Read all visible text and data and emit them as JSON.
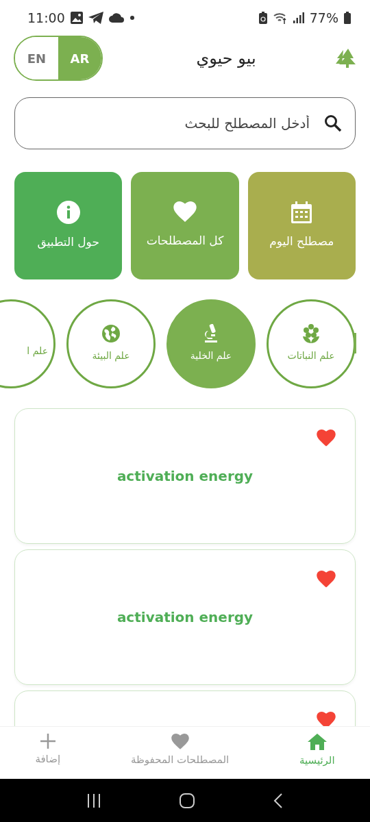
{
  "status_bar": {
    "time": "11:00",
    "battery": "77%"
  },
  "header": {
    "title": "بيو حيوي",
    "languages": [
      {
        "label": "AR",
        "selected": true
      },
      {
        "label": "EN",
        "selected": false
      }
    ]
  },
  "search": {
    "placeholder": "أدخل المصطلح للبحث"
  },
  "tiles": [
    {
      "label": "مصطلح اليوم",
      "color": "#a9ae4e"
    },
    {
      "label": "كل المصطلحات",
      "color": "#7cb050"
    },
    {
      "label": "حول التطبيق",
      "color": "#4fae56"
    }
  ],
  "categories": [
    {
      "label": "علم النباتات",
      "selected": false
    },
    {
      "label": "علم الخلية",
      "selected": true
    },
    {
      "label": "علم البيئة",
      "selected": false
    },
    {
      "label": "علم ا",
      "selected": false
    }
  ],
  "terms": [
    {
      "term": "activation energy",
      "favorite": true
    },
    {
      "term": "activation energy",
      "favorite": true
    },
    {
      "favorite": true
    }
  ],
  "bottom_nav": [
    {
      "label": "الرئيسية",
      "selected": true
    },
    {
      "label": "المصطلحات المحفوظة",
      "selected": false
    },
    {
      "label": "إضافة",
      "selected": false
    }
  ]
}
